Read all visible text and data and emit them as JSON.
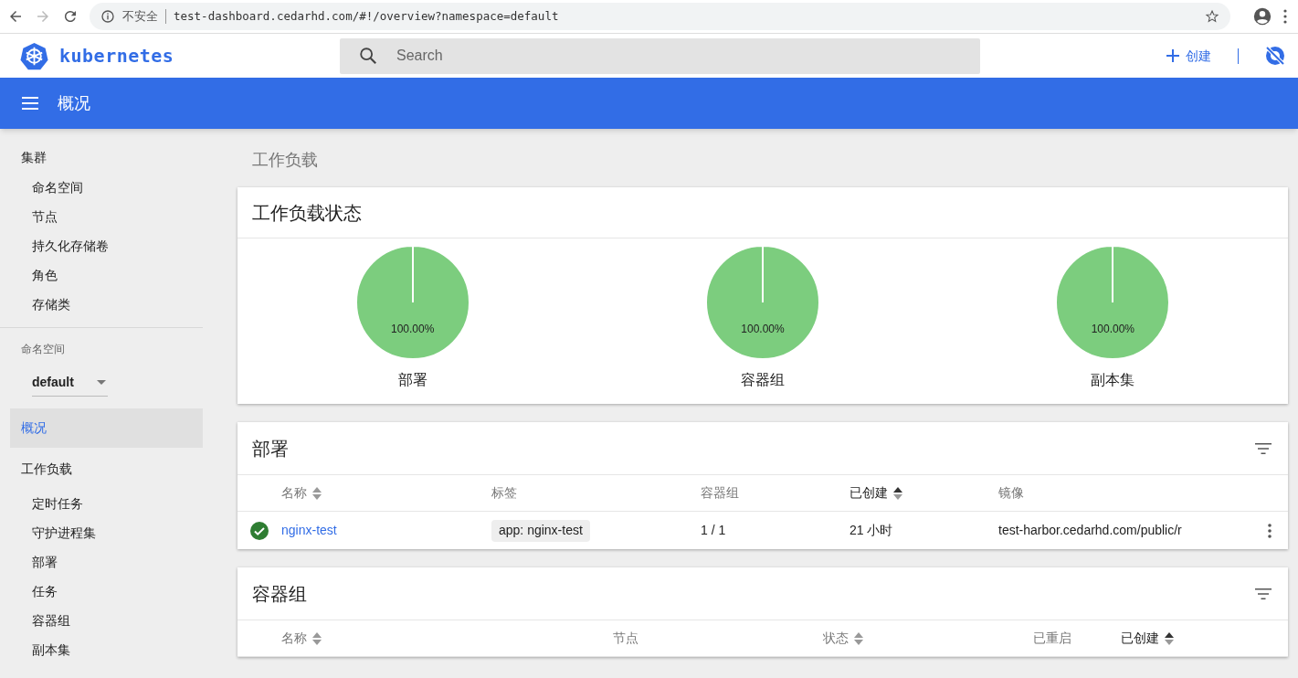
{
  "browser": {
    "security": "不安全",
    "url": "test-dashboard.cedarhd.com/#!/overview?namespace=default"
  },
  "header": {
    "logo_text": "kubernetes",
    "search_placeholder": "Search",
    "create_label": "创建"
  },
  "toolbar": {
    "title": "概况"
  },
  "sidebar": {
    "cluster": {
      "label": "集群",
      "children": [
        {
          "label": "命名空间",
          "selected": false
        },
        {
          "label": "节点",
          "selected": false
        },
        {
          "label": "持久化存储卷",
          "selected": false
        },
        {
          "label": "角色",
          "selected": false
        },
        {
          "label": "存储类",
          "selected": false
        }
      ]
    },
    "namespace_selector": {
      "label": "命名空间",
      "value": "default"
    },
    "items": [
      {
        "label": "概况",
        "selected": true
      },
      {
        "label": "工作负载",
        "selected": false,
        "children": [
          {
            "label": "定时任务",
            "selected": false
          },
          {
            "label": "守护进程集",
            "selected": false
          },
          {
            "label": "部署",
            "selected": false
          },
          {
            "label": "任务",
            "selected": false
          },
          {
            "label": "容器组",
            "selected": false
          },
          {
            "label": "副本集",
            "selected": false
          }
        ]
      }
    ]
  },
  "main": {
    "page_title": "工作负载",
    "status_card": {
      "title": "工作负载状态",
      "charts": [
        {
          "chart_data": {
            "type": "pie",
            "title": "部署",
            "values": [
              100
            ],
            "value_labels": [
              "100.00%"
            ]
          }
        },
        {
          "chart_data": {
            "type": "pie",
            "title": "容器组",
            "values": [
              100
            ],
            "value_labels": [
              "100.00%"
            ]
          }
        },
        {
          "chart_data": {
            "type": "pie",
            "title": "副本集",
            "values": [
              100
            ],
            "value_labels": [
              "100.00%"
            ]
          }
        }
      ]
    },
    "deployments": {
      "title": "部署",
      "columns": [
        {
          "label": "名称",
          "sortable": true,
          "sorted": false
        },
        {
          "label": "标签",
          "sortable": false,
          "sorted": false
        },
        {
          "label": "容器组",
          "sortable": false,
          "sorted": false
        },
        {
          "label": "已创建",
          "sortable": true,
          "sorted": true
        },
        {
          "label": "镜像",
          "sortable": false,
          "sorted": false
        }
      ],
      "rows": [
        {
          "healthy": true,
          "name": "nginx-test",
          "labels": [
            "app: nginx-test"
          ],
          "pods": "1 / 1",
          "created": "21 小时",
          "image": "test-harbor.cedarhd.com/public/r"
        }
      ]
    },
    "pods": {
      "title": "容器组",
      "columns": [
        {
          "label": "名称",
          "sortable": true,
          "sorted": false
        },
        {
          "label": "节点",
          "sortable": false,
          "sorted": false
        },
        {
          "label": "状态",
          "sortable": true,
          "sorted": false
        },
        {
          "label": "已重启",
          "sortable": false,
          "sorted": false
        },
        {
          "label": "已创建",
          "sortable": true,
          "sorted": true
        }
      ]
    }
  }
}
